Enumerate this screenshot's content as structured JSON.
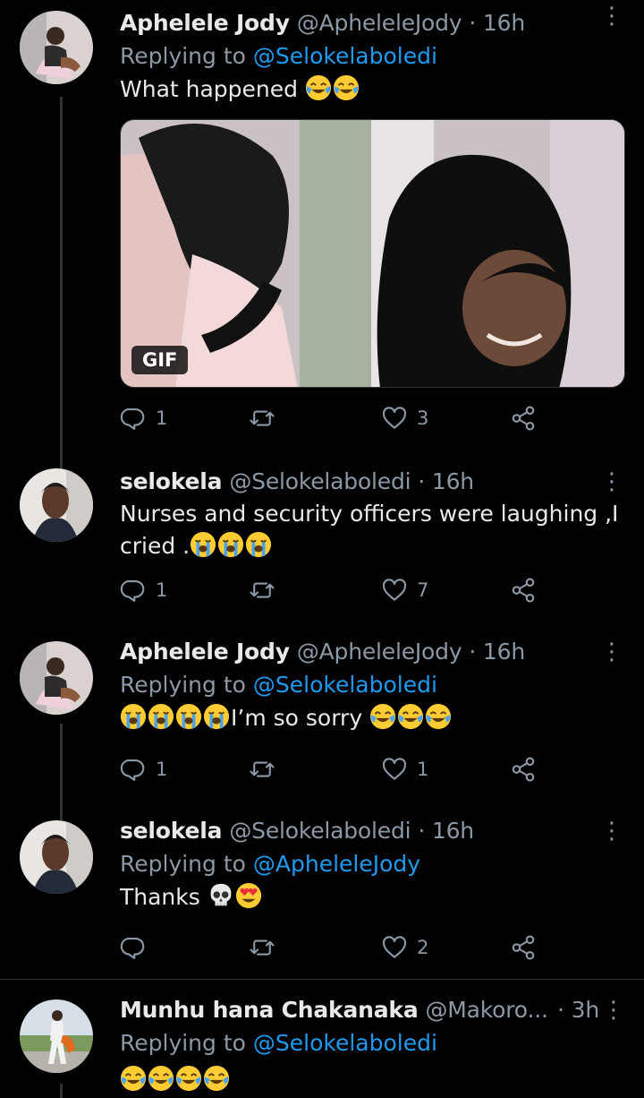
{
  "colors": {
    "background": "#000000",
    "text": "#e7e9ea",
    "secondary": "#8b98a5",
    "link": "#1d9bf0"
  },
  "tweets": [
    {
      "name": "Aphelele Jody",
      "handle": "@ApheleleJody",
      "time": "· 16h",
      "reply_prefix": "Replying to",
      "reply_mention": "@Selokelaboledi",
      "text": "What happened",
      "media_badge": "GIF",
      "replies": "1",
      "retweets": "",
      "likes": "3"
    },
    {
      "name": "selokela",
      "handle": "@Selokelaboledi",
      "time": "· 16h",
      "text_line1": "Nurses and security officers were laughing ,I",
      "text_line2": "cried .",
      "replies": "1",
      "retweets": "",
      "likes": "7"
    },
    {
      "name": "Aphelele Jody",
      "handle": "@ApheleleJody",
      "time": "· 16h",
      "reply_prefix": "Replying to",
      "reply_mention": "@Selokelaboledi",
      "text": "I’m so sorry",
      "replies": "1",
      "retweets": "",
      "likes": "1"
    },
    {
      "name": "selokela",
      "handle": "@Selokelaboledi",
      "time": "· 16h",
      "reply_prefix": "Replying to",
      "reply_mention": "@ApheleleJody",
      "text": "Thanks",
      "replies": "",
      "retweets": "",
      "likes": "2"
    },
    {
      "name": "Munhu hana Chakanaka",
      "handle": "@Makoro...",
      "time": "· 3h",
      "reply_prefix": "Replying to",
      "reply_mention": "@Selokelaboledi"
    }
  ],
  "icons": {
    "reply": "reply-icon",
    "retweet": "retweet-icon",
    "like": "heart-icon",
    "share": "share-icon",
    "more": "more-icon"
  }
}
